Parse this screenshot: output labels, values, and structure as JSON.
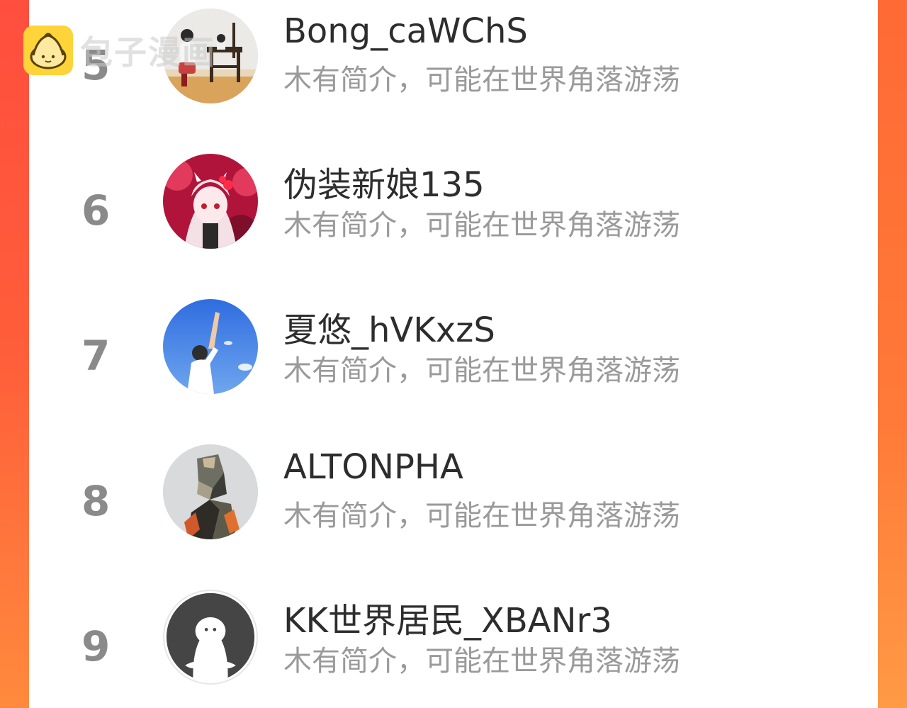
{
  "watermark": {
    "text": "包子漫画",
    "logo_icon": "bun-mascot-icon",
    "logo_color": "#ffd33a"
  },
  "colors": {
    "background_gradient_start": "#ff4e3e",
    "background_gradient_end": "#ff8a3d",
    "panel": "#ffffff",
    "rank_text": "#8a8a8a",
    "name_text": "#2d2d2d",
    "bio_text": "#9a9a9a"
  },
  "users": [
    {
      "rank": "5",
      "name": "Bong_caWChS",
      "bio": "木有简介，可能在世界角落游荡",
      "avatar_icon": "photo-avatar-room-icon"
    },
    {
      "rank": "6",
      "name": "伪装新娘135",
      "bio": "木有简介，可能在世界角落游荡",
      "avatar_icon": "anime-girl-avatar-icon"
    },
    {
      "rank": "7",
      "name": "夏悠_hVKxzS",
      "bio": "木有简介，可能在世界角落游荡",
      "avatar_icon": "sky-reaching-person-avatar-icon"
    },
    {
      "rank": "8",
      "name": "ALTONPHA",
      "bio": "木有简介，可能在世界角落游荡",
      "avatar_icon": "lowpoly-portrait-avatar-icon"
    },
    {
      "rank": "9",
      "name": "KK世界居民_XBANr3",
      "bio": "木有简介，可能在世界角落游荡",
      "avatar_icon": "default-ghost-avatar-icon"
    }
  ]
}
